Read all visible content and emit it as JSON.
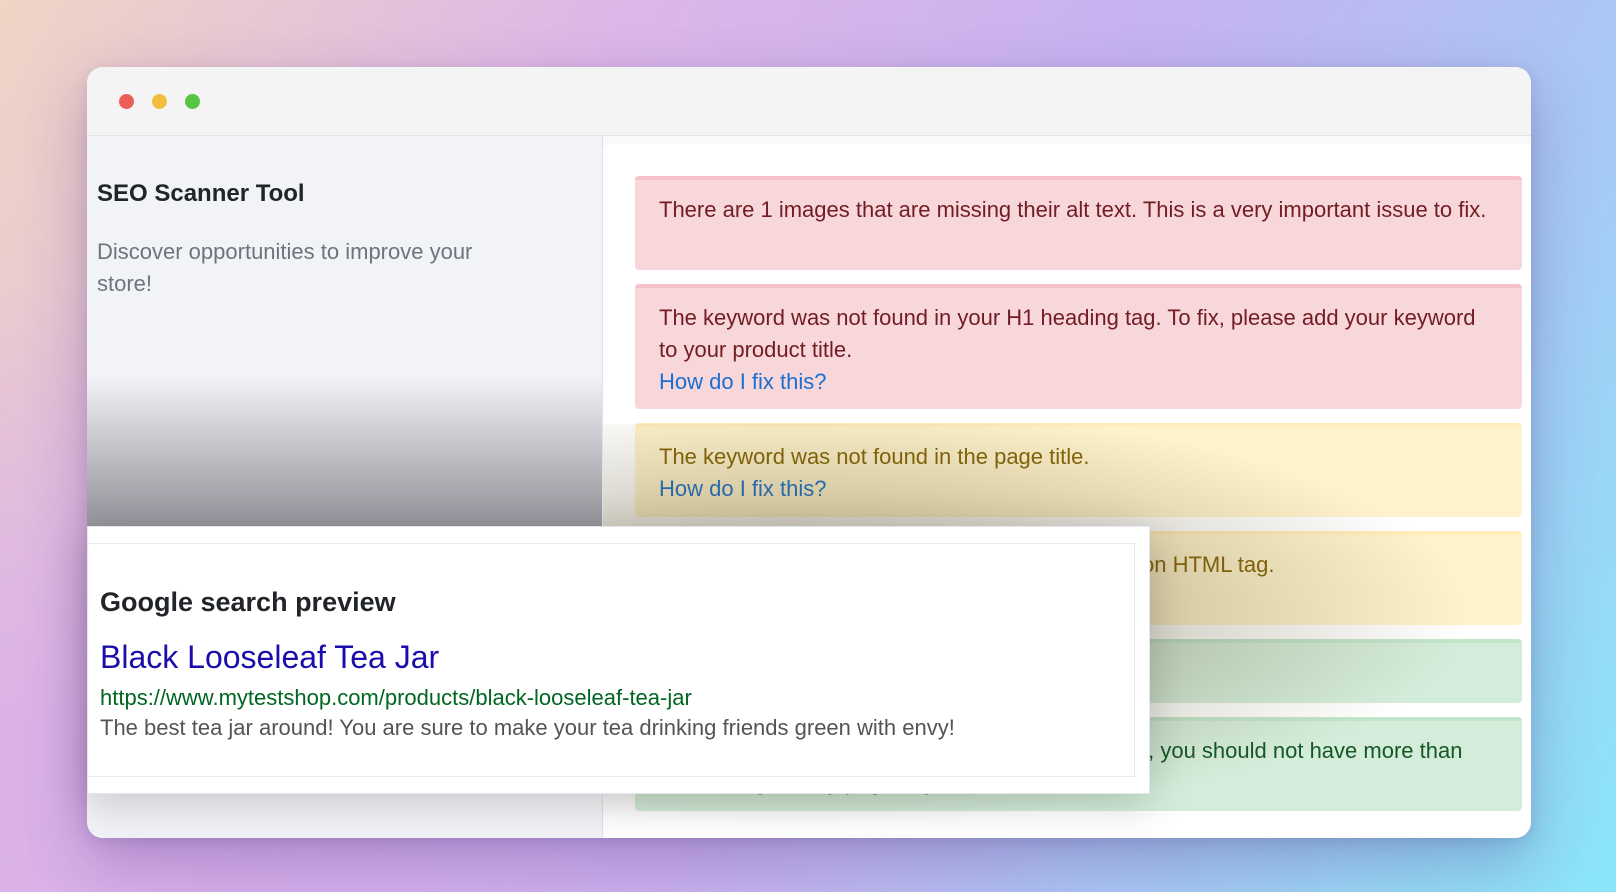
{
  "window": {
    "controls": [
      "close",
      "minimize",
      "maximize"
    ]
  },
  "sidebar": {
    "title": "SEO Scanner Tool",
    "subtitle": "Discover opportunities to improve your store!"
  },
  "alerts": [
    {
      "level": "danger",
      "text": "There are 1 images that are missing their alt text. This is a very important issue to fix.",
      "link": ""
    },
    {
      "level": "danger",
      "text": "The keyword was not found in your H1 heading tag. To fix, please add your keyword to your product title.",
      "link": "How do I fix this?"
    },
    {
      "level": "warning",
      "text": "The keyword was not found in the page title.",
      "link": "How do I fix this?"
    },
    {
      "level": "warning",
      "text": "tion HTML tag.",
      "link": ""
    },
    {
      "level": "success",
      "text": "",
      "link": ""
    },
    {
      "level": "success",
      "text": "al, you should not have more than one H1 tag on any page of your store.",
      "link": ""
    }
  ],
  "preview": {
    "heading": "Google search preview",
    "result_title": "Black Looseleaf Tea Jar",
    "result_url": "https://www.mytestshop.com/products/black-looseleaf-tea-jar",
    "result_description": "The best tea jar around! You are sure to make your tea drinking friends green with envy!"
  },
  "colors": {
    "danger_bg": "#f8d7da",
    "danger_text": "#721c24",
    "warning_bg": "#fff3cd",
    "warning_text": "#856404",
    "success_bg": "#d4edda",
    "success_text": "#155724",
    "link": "#1a6fd1",
    "serp_title": "#1a0dab",
    "serp_url": "#006621"
  }
}
